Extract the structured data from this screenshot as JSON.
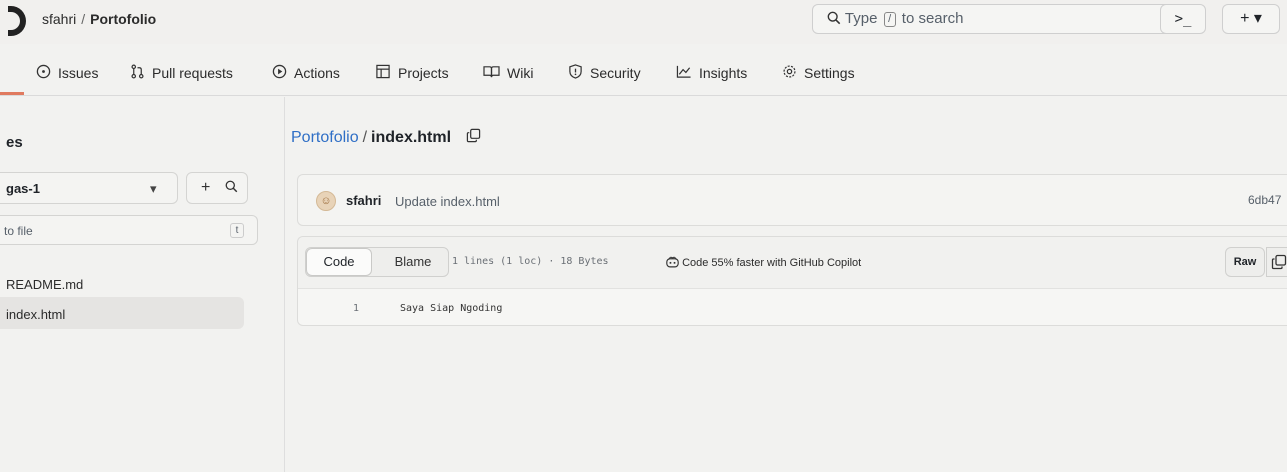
{
  "header": {
    "owner": "sfahri",
    "separator": "/",
    "repo": "Portofolio",
    "search_prefix": "Type",
    "search_key": "/",
    "search_suffix": "to search",
    "terminal_label": ">_",
    "new_label": "+ ▾"
  },
  "nav": {
    "items": [
      {
        "label": "Issues",
        "icon": "issue-icon"
      },
      {
        "label": "Pull requests",
        "icon": "pull-request-icon"
      },
      {
        "label": "Actions",
        "icon": "actions-icon"
      },
      {
        "label": "Projects",
        "icon": "projects-icon"
      },
      {
        "label": "Wiki",
        "icon": "wiki-icon"
      },
      {
        "label": "Security",
        "icon": "security-icon"
      },
      {
        "label": "Insights",
        "icon": "insights-icon"
      },
      {
        "label": "Settings",
        "icon": "settings-icon"
      }
    ]
  },
  "sidebar": {
    "title": "es",
    "branch": "gas-1",
    "goto_placeholder": "to file",
    "goto_key": "t",
    "files": [
      {
        "name": "README.md"
      },
      {
        "name": "index.html",
        "active": true
      }
    ]
  },
  "breadcrumb": {
    "repo": "Portofolio",
    "file": "index.html"
  },
  "commit": {
    "author": "sfahri",
    "message": "Update index.html",
    "sha": "6db47"
  },
  "file_view": {
    "code_tab": "Code",
    "blame_tab": "Blame",
    "meta": "1 lines (1 loc) · 18 Bytes",
    "copilot": "Code 55% faster with GitHub Copilot",
    "raw_label": "Raw",
    "lines": [
      {
        "num": "1",
        "text": "Saya Siap Ngoding"
      }
    ]
  },
  "colors": {
    "link": "#2f6fc6",
    "active_underline": "#e07a5f"
  }
}
